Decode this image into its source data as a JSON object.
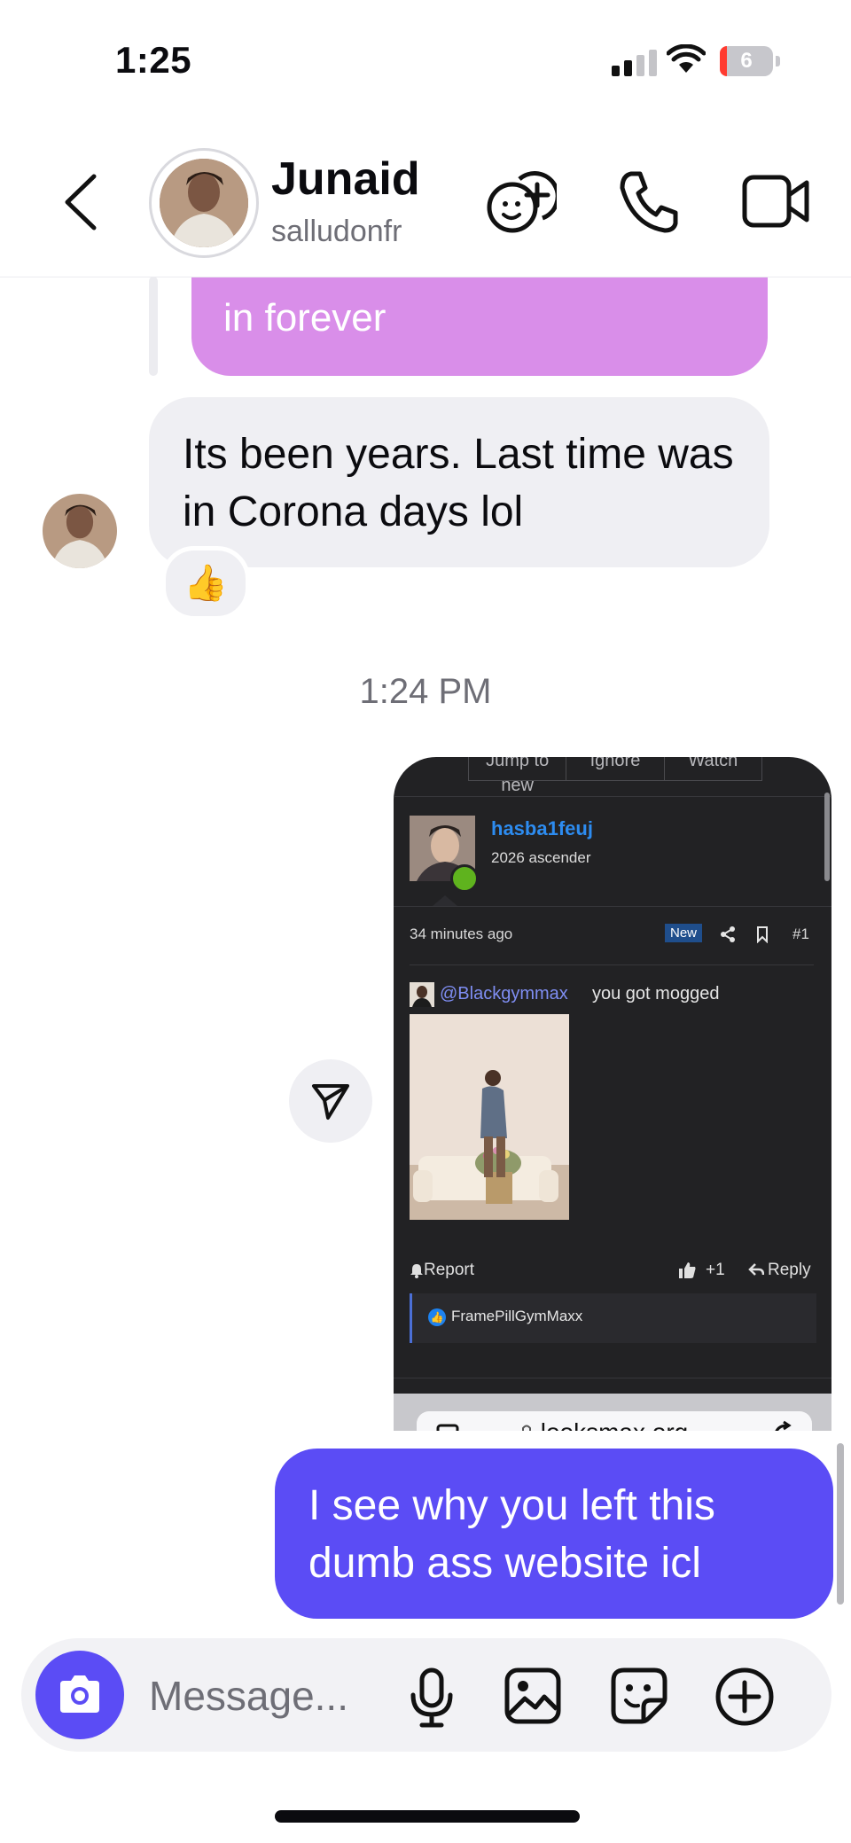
{
  "status_bar": {
    "time": "1:25",
    "battery": "6"
  },
  "header": {
    "name": "Junaid",
    "handle": "salludonfr"
  },
  "messages": {
    "quoted_partial": "in forever",
    "incoming_text": "Its been years. Last time was in Corona days lol",
    "incoming_reaction": "👍",
    "timestamp": "1:24 PM",
    "outgoing_text": "I see why you left this dumb ass website icl"
  },
  "shared_screenshot": {
    "top_tabs": [
      "Jump to new",
      "Ignore",
      "Watch"
    ],
    "username": "hasba1feuj",
    "user_title": "2026 ascender",
    "posted": "34 minutes ago",
    "badge": "New",
    "post_number": "#1",
    "mention": "@Blackgymmax",
    "post_text": "you got mogged",
    "report_label": "Report",
    "like_count": "+1",
    "reply_label": "Reply",
    "reactor": "FramePillGymMaxx",
    "url": "looksmax.org"
  },
  "composer": {
    "placeholder": "Message..."
  },
  "colors": {
    "outgoing_bubble": "#5b4cf5",
    "quote_bubble": "#d98ee9",
    "incoming_bubble": "#efeff3",
    "link": "#2d8cf0"
  }
}
